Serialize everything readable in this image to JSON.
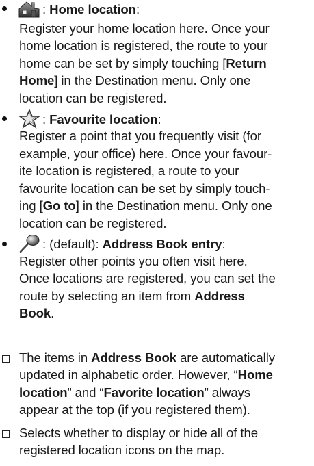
{
  "items": [
    {
      "icon": "home-icon",
      "sep": " : ",
      "title": "Home location",
      "colon": ":",
      "lines": [
        "Register your home location here. Once your",
        "home location is registered, the route to your",
        "home can be set by simply touching [",
        "Return",
        "Home",
        "] in the Destination menu. Only one",
        "location can be registered."
      ]
    },
    {
      "icon": "star-icon",
      "sep": " : ",
      "title": "Favourite location",
      "colon": ":",
      "lines": [
        "Register a point that you frequently visit (for",
        "example, your office) here. Once your favour-",
        "ite location is registered, a route to your",
        "favourite location can be set by simply touch-",
        "ing [",
        "Go to",
        "] in the Destination menu. Only one",
        "location can be registered."
      ]
    },
    {
      "icon": "pin-icon",
      "sep": " : (default): ",
      "title": "Address Book entry",
      "colon": ":",
      "lines": [
        "Register other points you often visit here.",
        "Once locations are registered, you can set the",
        "route by selecting an item from ",
        "Address",
        "Book",
        "."
      ]
    }
  ],
  "notes": [
    {
      "l1a": "The items in ",
      "l1b": "Address Book",
      "l1c": " are automatically",
      "l2a": "updated in alphabetic order. However, “",
      "l2b": "Home",
      "l3a": "location",
      "l3b": "” and “",
      "l3c": "Favorite location",
      "l3d": "” always",
      "l4": "appear at the top (if you registered them)."
    },
    {
      "l1": "Selects whether to display or hide all of the",
      "l2": "registered location icons on the map."
    }
  ]
}
